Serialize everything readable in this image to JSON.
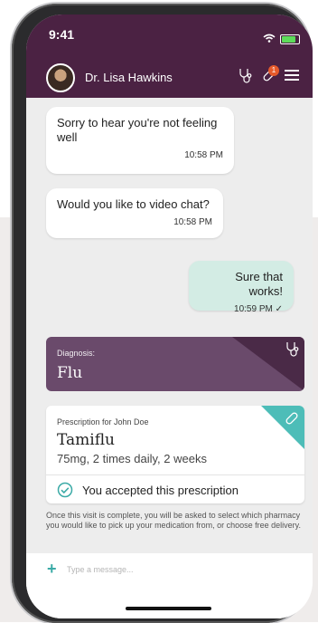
{
  "status_bar": {
    "time": "9:41"
  },
  "header": {
    "doctor_name": "Dr. Lisa Hawkins",
    "notification_count": "1",
    "colors": {
      "header_bg": "#4b2243"
    }
  },
  "messages": [
    {
      "text": "Sorry to hear you're not feeling well",
      "time": "10:58 PM",
      "direction": "incoming"
    },
    {
      "text": "Would you like to video chat?",
      "time": "10:58 PM",
      "direction": "incoming"
    },
    {
      "text": "Sure that works!",
      "time": "10:59 PM",
      "direction": "outgoing",
      "status_mark": "✓"
    }
  ],
  "diagnosis": {
    "label": "Diagnosis:",
    "value": "Flu"
  },
  "prescription": {
    "for_label": "Prescription for John Doe",
    "drug": "Tamiflu",
    "detail": "75mg, 2 times daily, 2 weeks",
    "accepted_text": "You accepted this prescription"
  },
  "note": "Once this visit is complete, you will be asked to select which pharmacy you would like to pick up your medication from, or choose free delivery.",
  "composer": {
    "placeholder": "Type a message..."
  }
}
